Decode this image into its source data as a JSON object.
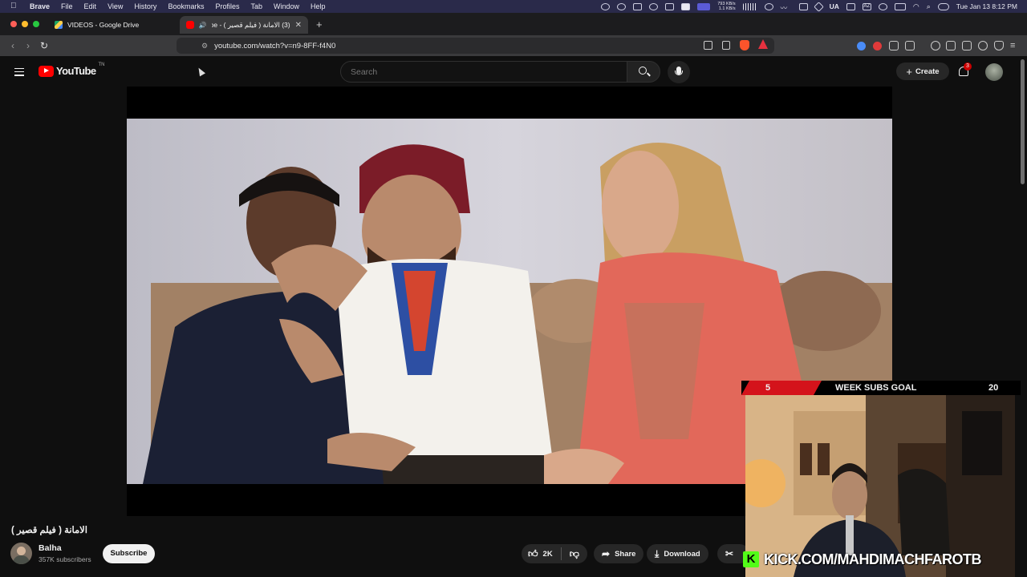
{
  "menubar": {
    "app": "Brave",
    "items": [
      "File",
      "Edit",
      "View",
      "History",
      "Bookmarks",
      "Profiles",
      "Tab",
      "Window",
      "Help"
    ],
    "net_up": "793 KB/s",
    "net_down": "1.1 KB/s",
    "keyboard": "UA",
    "datetime": "Tue Jan 13  8:12 PM"
  },
  "tabs": [
    {
      "label": "VIDEOS - Google Drive"
    },
    {
      "label": "(3) الامانة ( فيلم قصير ) - YouTube"
    }
  ],
  "url": "youtube.com/watch?v=n9-8FF-f4N0",
  "youtube": {
    "logo": "YouTube",
    "logo_suffix": "TN",
    "search_placeholder": "Search",
    "create_label": "Create",
    "notification_count": "3"
  },
  "video": {
    "title": "الامانة ( فيلم قصير )",
    "channel": "Balha",
    "subscribers": "357K subscribers",
    "subscribe_label": "Subscribe",
    "likes": "2K",
    "share_label": "Share",
    "download_label": "Download"
  },
  "overlay": {
    "goal_current": "5",
    "goal_label": "WEEK SUBS GOAL",
    "goal_target": "20",
    "kick_url": "KICK.COM/MAHDIMACHFAROTB"
  },
  "colors": {
    "youtube_red": "#ff0000",
    "brave_orange": "#fb542b",
    "kick_green": "#53fc18"
  }
}
